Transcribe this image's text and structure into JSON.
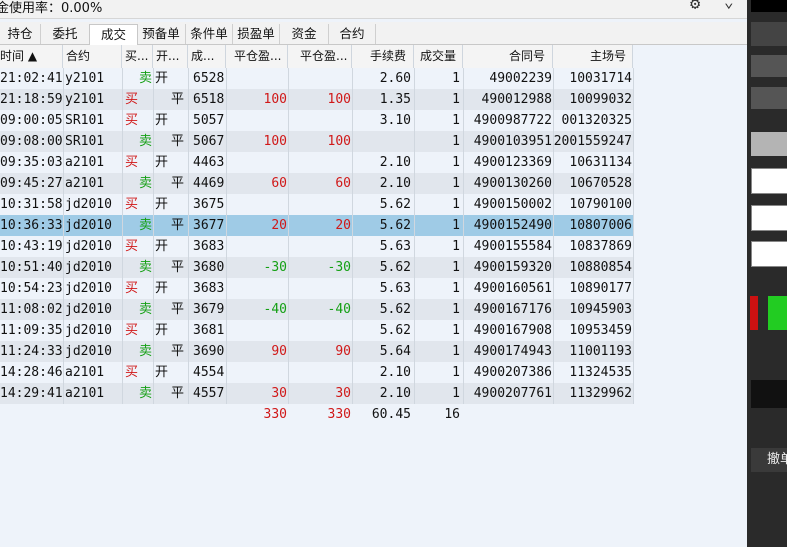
{
  "topbar": {
    "ratio_text": "金使用率：0.00%",
    "gear_icon": "gear-icon",
    "collapse_icon": "chevron-down-icon"
  },
  "tabs": [
    {
      "label": "持仓",
      "active": false
    },
    {
      "label": "委托",
      "active": false
    },
    {
      "label": "成交",
      "active": true
    },
    {
      "label": "预备单",
      "active": false
    },
    {
      "label": "条件单",
      "active": false
    },
    {
      "label": "损盈单",
      "active": false
    },
    {
      "label": "资金",
      "active": false
    },
    {
      "label": "合约",
      "active": false
    }
  ],
  "headers": {
    "time": "时间 ▲",
    "code": "合约",
    "side": "买...",
    "open_close": "开...",
    "price": "成...",
    "pnl1": "平仓盈...",
    "pnl2": "平仓盈...",
    "fee": "手续费",
    "qty": "成交量",
    "contract_no": "合同号",
    "main_no": "主场号"
  },
  "rows": [
    {
      "time": "21:02:41",
      "code": "y2101",
      "side": "卖",
      "oc": "开",
      "price": "6528",
      "pnl1": "",
      "pnl2": "",
      "fee": "2.60",
      "qty": "1",
      "cid": "49002239",
      "mid": "10031714"
    },
    {
      "time": "21:18:59",
      "code": "y2101",
      "side": "买",
      "oc": "平",
      "price": "6518",
      "pnl1": "100",
      "pnl2": "100",
      "fee": "1.35",
      "qty": "1",
      "cid": "490012988",
      "mid": "10099032"
    },
    {
      "time": "09:00:05",
      "code": "SR101",
      "side": "买",
      "oc": "开",
      "price": "5057",
      "pnl1": "",
      "pnl2": "",
      "fee": "3.10",
      "qty": "1",
      "cid": "4900987722",
      "mid": "001320325"
    },
    {
      "time": "09:08:00",
      "code": "SR101",
      "side": "卖",
      "oc": "平",
      "price": "5067",
      "pnl1": "100",
      "pnl2": "100",
      "fee": "",
      "qty": "1",
      "cid": "4900103951",
      "mid": "2001559247"
    },
    {
      "time": "09:35:03",
      "code": "a2101",
      "side": "买",
      "oc": "开",
      "price": "4463",
      "pnl1": "",
      "pnl2": "",
      "fee": "2.10",
      "qty": "1",
      "cid": "4900123369",
      "mid": "10631134"
    },
    {
      "time": "09:45:27",
      "code": "a2101",
      "side": "卖",
      "oc": "平",
      "price": "4469",
      "pnl1": "60",
      "pnl2": "60",
      "fee": "2.10",
      "qty": "1",
      "cid": "4900130260",
      "mid": "10670528"
    },
    {
      "time": "10:31:58",
      "code": "jd2010",
      "side": "买",
      "oc": "开",
      "price": "3675",
      "pnl1": "",
      "pnl2": "",
      "fee": "5.62",
      "qty": "1",
      "cid": "4900150002",
      "mid": "10790100"
    },
    {
      "time": "10:36:33",
      "code": "jd2010",
      "side": "卖",
      "oc": "平",
      "price": "3677",
      "pnl1": "20",
      "pnl2": "20",
      "fee": "5.62",
      "qty": "1",
      "cid": "4900152490",
      "mid": "10807006",
      "selected": true
    },
    {
      "time": "10:43:19",
      "code": "jd2010",
      "side": "买",
      "oc": "开",
      "price": "3683",
      "pnl1": "",
      "pnl2": "",
      "fee": "5.63",
      "qty": "1",
      "cid": "4900155584",
      "mid": "10837869"
    },
    {
      "time": "10:51:40",
      "code": "jd2010",
      "side": "卖",
      "oc": "平",
      "price": "3680",
      "pnl1": "-30",
      "pnl2": "-30",
      "fee": "5.62",
      "qty": "1",
      "cid": "4900159320",
      "mid": "10880854"
    },
    {
      "time": "10:54:23",
      "code": "jd2010",
      "side": "买",
      "oc": "开",
      "price": "3683",
      "pnl1": "",
      "pnl2": "",
      "fee": "5.63",
      "qty": "1",
      "cid": "4900160561",
      "mid": "10890177"
    },
    {
      "time": "11:08:02",
      "code": "jd2010",
      "side": "卖",
      "oc": "平",
      "price": "3679",
      "pnl1": "-40",
      "pnl2": "-40",
      "fee": "5.62",
      "qty": "1",
      "cid": "4900167176",
      "mid": "10945903"
    },
    {
      "time": "11:09:35",
      "code": "jd2010",
      "side": "买",
      "oc": "开",
      "price": "3681",
      "pnl1": "",
      "pnl2": "",
      "fee": "5.62",
      "qty": "1",
      "cid": "4900167908",
      "mid": "10953459"
    },
    {
      "time": "11:24:33",
      "code": "jd2010",
      "side": "卖",
      "oc": "平",
      "price": "3690",
      "pnl1": "90",
      "pnl2": "90",
      "fee": "5.64",
      "qty": "1",
      "cid": "4900174943",
      "mid": "11001193"
    },
    {
      "time": "14:28:46",
      "code": "a2101",
      "side": "买",
      "oc": "开",
      "price": "4554",
      "pnl1": "",
      "pnl2": "",
      "fee": "2.10",
      "qty": "1",
      "cid": "4900207386",
      "mid": "11324535"
    },
    {
      "time": "14:29:41",
      "code": "a2101",
      "side": "卖",
      "oc": "平",
      "price": "4557",
      "pnl1": "30",
      "pnl2": "30",
      "fee": "2.10",
      "qty": "1",
      "cid": "4900207761",
      "mid": "11329962"
    }
  ],
  "totals": {
    "pnl1": "330",
    "pnl2": "330",
    "fee": "60.45",
    "qty": "16"
  },
  "right_panel": {
    "cancel_label": "撤单"
  },
  "colors": {
    "buy": "#d01818",
    "sell": "#15a015",
    "selected_row": "#9fcbe6",
    "accent_red": "#cc1111",
    "accent_green": "#22cc22"
  }
}
